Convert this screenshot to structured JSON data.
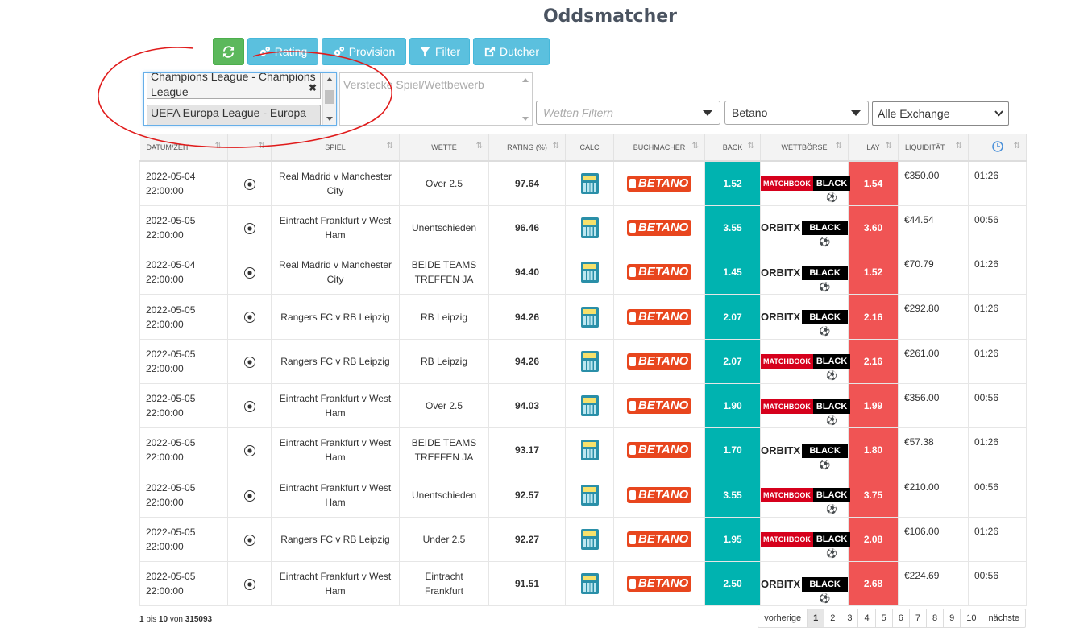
{
  "page_title": "Oddsmatcher",
  "toolbar": {
    "refresh_icon": "refresh-icon",
    "buttons": [
      {
        "label": "Rating",
        "icon": "cogs-icon"
      },
      {
        "label": "Provision",
        "icon": "cogs-icon"
      },
      {
        "label": "Filter",
        "icon": "filter-icon"
      },
      {
        "label": "Dutcher",
        "icon": "external-link-icon"
      }
    ]
  },
  "filters": {
    "competitions": [
      "Champions League - Champions League",
      "UEFA Europa League - Europa"
    ],
    "hide_placeholder": "Verstecke Spiel/Wettbewerb",
    "bets_placeholder": "Wetten Filtern",
    "bookmaker": "Betano",
    "exchange": "Alle Exchange"
  },
  "table": {
    "headers": [
      "Datum/Zeit",
      "",
      "Spiel",
      "Wette",
      "Rating (%)",
      "Calc",
      "Buchmacher",
      "Back",
      "Wettbörse",
      "Lay",
      "Liquidität",
      ""
    ],
    "rows": [
      {
        "date": "2022-05-04",
        "time": "22:00:00",
        "match": "Real Madrid v Manchester City",
        "bet": "Over 2.5",
        "rating": "97.64",
        "bookmaker": "BETANO",
        "back": "1.52",
        "exchange": "matchbook",
        "lay": "1.54",
        "liquidity": "€350.00",
        "countdown": "01:26"
      },
      {
        "date": "2022-05-05",
        "time": "22:00:00",
        "match": "Eintracht Frankfurt v West Ham",
        "bet": "Unentschieden",
        "rating": "96.46",
        "bookmaker": "BETANO",
        "back": "3.55",
        "exchange": "orbitx",
        "lay": "3.60",
        "liquidity": "€44.54",
        "countdown": "00:56"
      },
      {
        "date": "2022-05-04",
        "time": "22:00:00",
        "match": "Real Madrid v Manchester City",
        "bet": "BEIDE TEAMS TREFFEN JA",
        "rating": "94.40",
        "bookmaker": "BETANO",
        "back": "1.45",
        "exchange": "orbitx",
        "lay": "1.52",
        "liquidity": "€70.79",
        "countdown": "01:26"
      },
      {
        "date": "2022-05-05",
        "time": "22:00:00",
        "match": "Rangers FC v RB Leipzig",
        "bet": "RB Leipzig",
        "rating": "94.26",
        "bookmaker": "BETANO",
        "back": "2.07",
        "exchange": "orbitx",
        "lay": "2.16",
        "liquidity": "€292.80",
        "countdown": "01:26"
      },
      {
        "date": "2022-05-05",
        "time": "22:00:00",
        "match": "Rangers FC v RB Leipzig",
        "bet": "RB Leipzig",
        "rating": "94.26",
        "bookmaker": "BETANO",
        "back": "2.07",
        "exchange": "matchbook",
        "lay": "2.16",
        "liquidity": "€261.00",
        "countdown": "01:26"
      },
      {
        "date": "2022-05-05",
        "time": "22:00:00",
        "match": "Eintracht Frankfurt v West Ham",
        "bet": "Over 2.5",
        "rating": "94.03",
        "bookmaker": "BETANO",
        "back": "1.90",
        "exchange": "matchbook",
        "lay": "1.99",
        "liquidity": "€356.00",
        "countdown": "00:56"
      },
      {
        "date": "2022-05-05",
        "time": "22:00:00",
        "match": "Eintracht Frankfurt v West Ham",
        "bet": "BEIDE TEAMS TREFFEN JA",
        "rating": "93.17",
        "bookmaker": "BETANO",
        "back": "1.70",
        "exchange": "orbitx",
        "lay": "1.80",
        "liquidity": "€57.38",
        "countdown": "01:26"
      },
      {
        "date": "2022-05-05",
        "time": "22:00:00",
        "match": "Eintracht Frankfurt v West Ham",
        "bet": "Unentschieden",
        "rating": "92.57",
        "bookmaker": "BETANO",
        "back": "3.55",
        "exchange": "matchbook",
        "lay": "3.75",
        "liquidity": "€210.00",
        "countdown": "00:56"
      },
      {
        "date": "2022-05-05",
        "time": "22:00:00",
        "match": "Rangers FC v RB Leipzig",
        "bet": "Under 2.5",
        "rating": "92.27",
        "bookmaker": "BETANO",
        "back": "1.95",
        "exchange": "matchbook",
        "lay": "2.08",
        "liquidity": "€106.00",
        "countdown": "01:26"
      },
      {
        "date": "2022-05-05",
        "time": "22:00:00",
        "match": "Eintracht Frankfurt v West Ham",
        "bet": "Eintracht Frankfurt",
        "rating": "91.51",
        "bookmaker": "BETANO",
        "back": "2.50",
        "exchange": "orbitx",
        "lay": "2.68",
        "liquidity": "€224.69",
        "countdown": "00:56"
      }
    ]
  },
  "footer": {
    "from": "1",
    "bis": "bis",
    "to": "10",
    "von": "von",
    "total": "315093",
    "pagination": {
      "prev": "vorherige",
      "pages": [
        "1",
        "2",
        "3",
        "4",
        "5",
        "6",
        "7",
        "8",
        "9",
        "10"
      ],
      "active": "1",
      "next": "nächste"
    }
  },
  "colors": {
    "back": "#00b3b0",
    "lay": "#f05454",
    "refresh": "#5cb85c",
    "info": "#5bc0de",
    "annotation": "#e01b1b"
  }
}
